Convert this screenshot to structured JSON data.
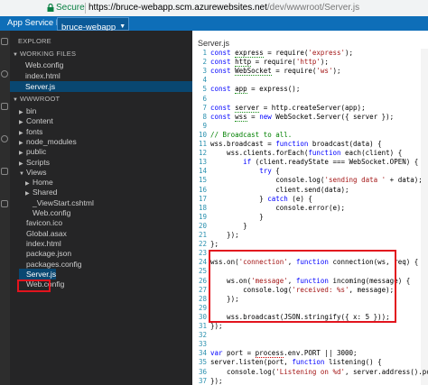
{
  "browser": {
    "secure_label": "Secure",
    "url_host": "https://bruce-webapp.scm.azurewebsites.net",
    "url_path": "/dev/wwwroot/Server.js"
  },
  "header": {
    "app_title": "App Service Editor",
    "site_name": "bruce-webapp"
  },
  "explorer": {
    "title": "EXPLORE",
    "working_files_label": "WORKING FILES",
    "working_files": [
      "Web.config",
      "index.html",
      "Server.js"
    ],
    "wwwroot_label": "WWWROOT",
    "tree": [
      {
        "label": "bin",
        "indent": 1,
        "folder": true,
        "open": false
      },
      {
        "label": "Content",
        "indent": 1,
        "folder": true,
        "open": false
      },
      {
        "label": "fonts",
        "indent": 1,
        "folder": true,
        "open": false
      },
      {
        "label": "node_modules",
        "indent": 1,
        "folder": true,
        "open": false
      },
      {
        "label": "public",
        "indent": 1,
        "folder": true,
        "open": false
      },
      {
        "label": "Scripts",
        "indent": 1,
        "folder": true,
        "open": false
      },
      {
        "label": "Views",
        "indent": 1,
        "folder": true,
        "open": true
      },
      {
        "label": "Home",
        "indent": 2,
        "folder": true,
        "open": false
      },
      {
        "label": "Shared",
        "indent": 2,
        "folder": true,
        "open": false
      },
      {
        "label": "_ViewStart.cshtml",
        "indent": 2,
        "folder": false
      },
      {
        "label": "Web.config",
        "indent": 2,
        "folder": false
      },
      {
        "label": "favicon.ico",
        "indent": 1,
        "folder": false
      },
      {
        "label": "Global.asax",
        "indent": 1,
        "folder": false
      },
      {
        "label": "index.html",
        "indent": 1,
        "folder": false
      },
      {
        "label": "package.json",
        "indent": 1,
        "folder": false
      },
      {
        "label": "packages.config",
        "indent": 1,
        "folder": false
      },
      {
        "label": "Server.js",
        "indent": 1,
        "folder": false,
        "selected": true
      },
      {
        "label": "Web.config",
        "indent": 1,
        "folder": false
      }
    ]
  },
  "editor": {
    "file_title": "Server.js",
    "lines": [
      {
        "n": "1",
        "html": "<span class=\"kw\">const</span> <span class=\"und\">express</span> = require(<span class=\"str\">'express'</span>);"
      },
      {
        "n": "2",
        "html": "<span class=\"kw\">const</span> <span class=\"und\">http</span> = require(<span class=\"str\">'http'</span>);"
      },
      {
        "n": "3",
        "html": "<span class=\"kw\">const</span> <span class=\"und\">WebSocket</span> = require(<span class=\"str\">'ws'</span>);"
      },
      {
        "n": "4",
        "html": ""
      },
      {
        "n": "5",
        "html": "<span class=\"kw\">const</span> <span class=\"und\">app</span> = express();"
      },
      {
        "n": "6",
        "html": ""
      },
      {
        "n": "7",
        "html": "<span class=\"kw\">const</span> <span class=\"und\">server</span> = http.createServer(app);"
      },
      {
        "n": "8",
        "html": "<span class=\"kw\">const</span> <span class=\"und\">wss</span> = <span class=\"kw\">new</span> WebSocket.Server({ server });"
      },
      {
        "n": "9",
        "html": ""
      },
      {
        "n": "10",
        "html": "<span class=\"com\">// Broadcast to all.</span>"
      },
      {
        "n": "11",
        "html": "wss.broadcast = <span class=\"kw\">function</span> broadcast(data) {"
      },
      {
        "n": "12",
        "html": "    wss.clients.forEach(<span class=\"kw\">function</span> each(client) {"
      },
      {
        "n": "13",
        "html": "        <span class=\"kw\">if</span> (client.readyState === WebSocket.OPEN) {"
      },
      {
        "n": "14",
        "html": "            <span class=\"kw\">try</span> {"
      },
      {
        "n": "15",
        "html": "                console.log(<span class=\"str\">'sending data '</span> + data);"
      },
      {
        "n": "16",
        "html": "                client.send(data);"
      },
      {
        "n": "17",
        "html": "            } <span class=\"kw\">catch</span> (e) {"
      },
      {
        "n": "18",
        "html": "                console.error(e);"
      },
      {
        "n": "19",
        "html": "            }"
      },
      {
        "n": "20",
        "html": "        }"
      },
      {
        "n": "21",
        "html": "    });"
      },
      {
        "n": "22",
        "html": "};"
      },
      {
        "n": "23",
        "html": ""
      },
      {
        "n": "24",
        "html": "wss.on(<span class=\"str\">'connection'</span>, <span class=\"kw\">function</span> connection(ws, req) {"
      },
      {
        "n": "25",
        "html": ""
      },
      {
        "n": "26",
        "html": "    ws.on(<span class=\"str\">'message'</span>, <span class=\"kw\">function</span> incoming(message) {"
      },
      {
        "n": "27",
        "html": "        console.log(<span class=\"str\">'received: %s'</span>, message);"
      },
      {
        "n": "28",
        "html": "    });"
      },
      {
        "n": "29",
        "html": ""
      },
      {
        "n": "30",
        "html": "    wss.broadcast(JSON.stringify({ x: 5 }));"
      },
      {
        "n": "31",
        "html": "});"
      },
      {
        "n": "32",
        "html": ""
      },
      {
        "n": "33",
        "html": ""
      },
      {
        "n": "34",
        "html": "<span class=\"kw\">var</span> port = <span class=\"und2\">process</span>.env.PORT || 3000;"
      },
      {
        "n": "35",
        "html": "server.listen(port, <span class=\"kw\">function</span> listening() {"
      },
      {
        "n": "36",
        "html": "    console.log(<span class=\"str\">'Listening on %d'</span>, server.address().port);"
      },
      {
        "n": "37",
        "html": "});"
      }
    ]
  },
  "colors": {
    "header_blue": "#0e6eb8",
    "explorer_bg": "#252526",
    "highlight_red": "#e2141e"
  }
}
